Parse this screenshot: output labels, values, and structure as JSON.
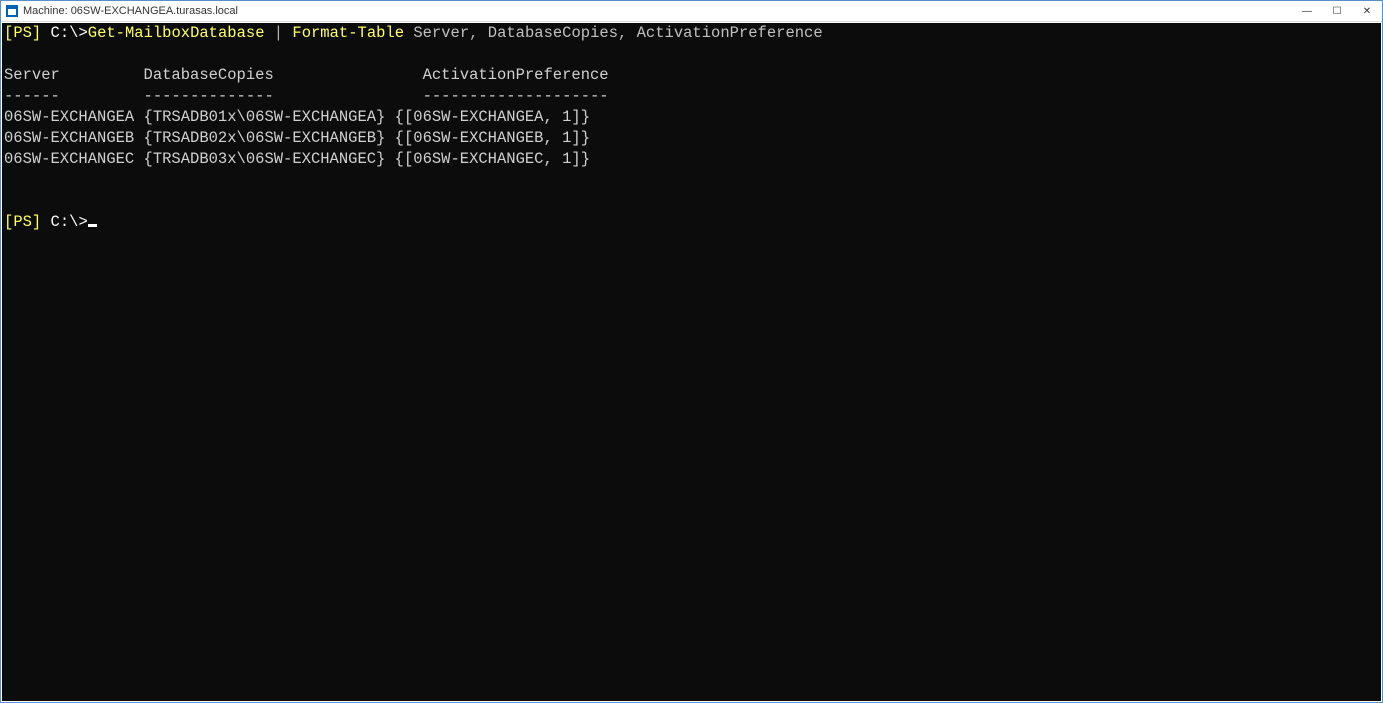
{
  "titlebar": {
    "title": "Machine: 06SW-EXCHANGEA.turasas.local"
  },
  "controls": {
    "minimize_glyph": "—",
    "maximize_glyph": "☐",
    "close_glyph": "✕"
  },
  "prompt": {
    "open": "[",
    "ps": "PS",
    "close": "]",
    "space": " ",
    "path": "C:\\>",
    "cmd1": "Get-MailboxDatabase",
    "pipe": " | ",
    "cmd2": "Format-Table",
    "arg1": " Server",
    "comma": ",",
    "arg2": " DatabaseCopies",
    "arg3": " ActivationPreference"
  },
  "headers": {
    "line": "Server         DatabaseCopies                ActivationPreference",
    "under": "------         --------------                --------------------"
  },
  "rows": [
    "06SW-EXCHANGEA {TRSADB01x\\06SW-EXCHANGEA} {[06SW-EXCHANGEA, 1]}",
    "06SW-EXCHANGEB {TRSADB02x\\06SW-EXCHANGEB} {[06SW-EXCHANGEB, 1]}",
    "06SW-EXCHANGEC {TRSADB03x\\06SW-EXCHANGEC} {[06SW-EXCHANGEC, 1]}"
  ],
  "prompt2": {
    "open": "[",
    "ps": "PS",
    "close": "]",
    "space": " ",
    "path": "C:\\>"
  }
}
